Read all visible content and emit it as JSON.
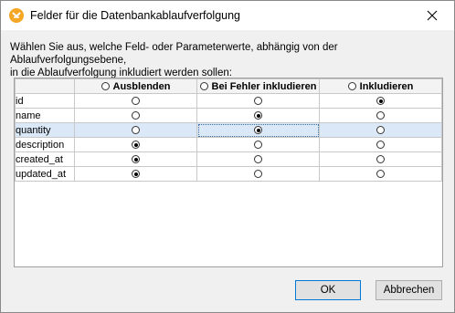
{
  "window": {
    "title": "Felder für die Datenbankablaufverfolgung"
  },
  "instructions": {
    "line1": "Wählen Sie aus, welche Feld- oder Parameterwerte, abhängig von der Ablaufverfolgungsebene,",
    "line2": "in die Ablaufverfolgung inkludiert werden sollen:"
  },
  "grid": {
    "columns": [
      "Ausblenden",
      "Bei Fehler inkludieren",
      "Inkludieren"
    ],
    "header_selected_column": null,
    "selected_row_index": 2,
    "focused_cell": {
      "row": 2,
      "col": 1
    },
    "rows": [
      {
        "name": "id",
        "selected": "Inkludieren"
      },
      {
        "name": "name",
        "selected": "Bei Fehler inkludieren"
      },
      {
        "name": "quantity",
        "selected": "Bei Fehler inkludieren"
      },
      {
        "name": "description",
        "selected": "Ausblenden"
      },
      {
        "name": "created_at",
        "selected": "Ausblenden"
      },
      {
        "name": "updated_at",
        "selected": "Ausblenden"
      }
    ]
  },
  "buttons": {
    "ok": "OK",
    "cancel": "Abbrechen"
  },
  "colors": {
    "app_icon": "#f5a623",
    "selected_row": "#dbe8f7",
    "dialog_bg": "#f0f0f0"
  },
  "icons": {
    "app": "altova-app-icon",
    "close": "close-icon",
    "radio": "radio-icon"
  }
}
